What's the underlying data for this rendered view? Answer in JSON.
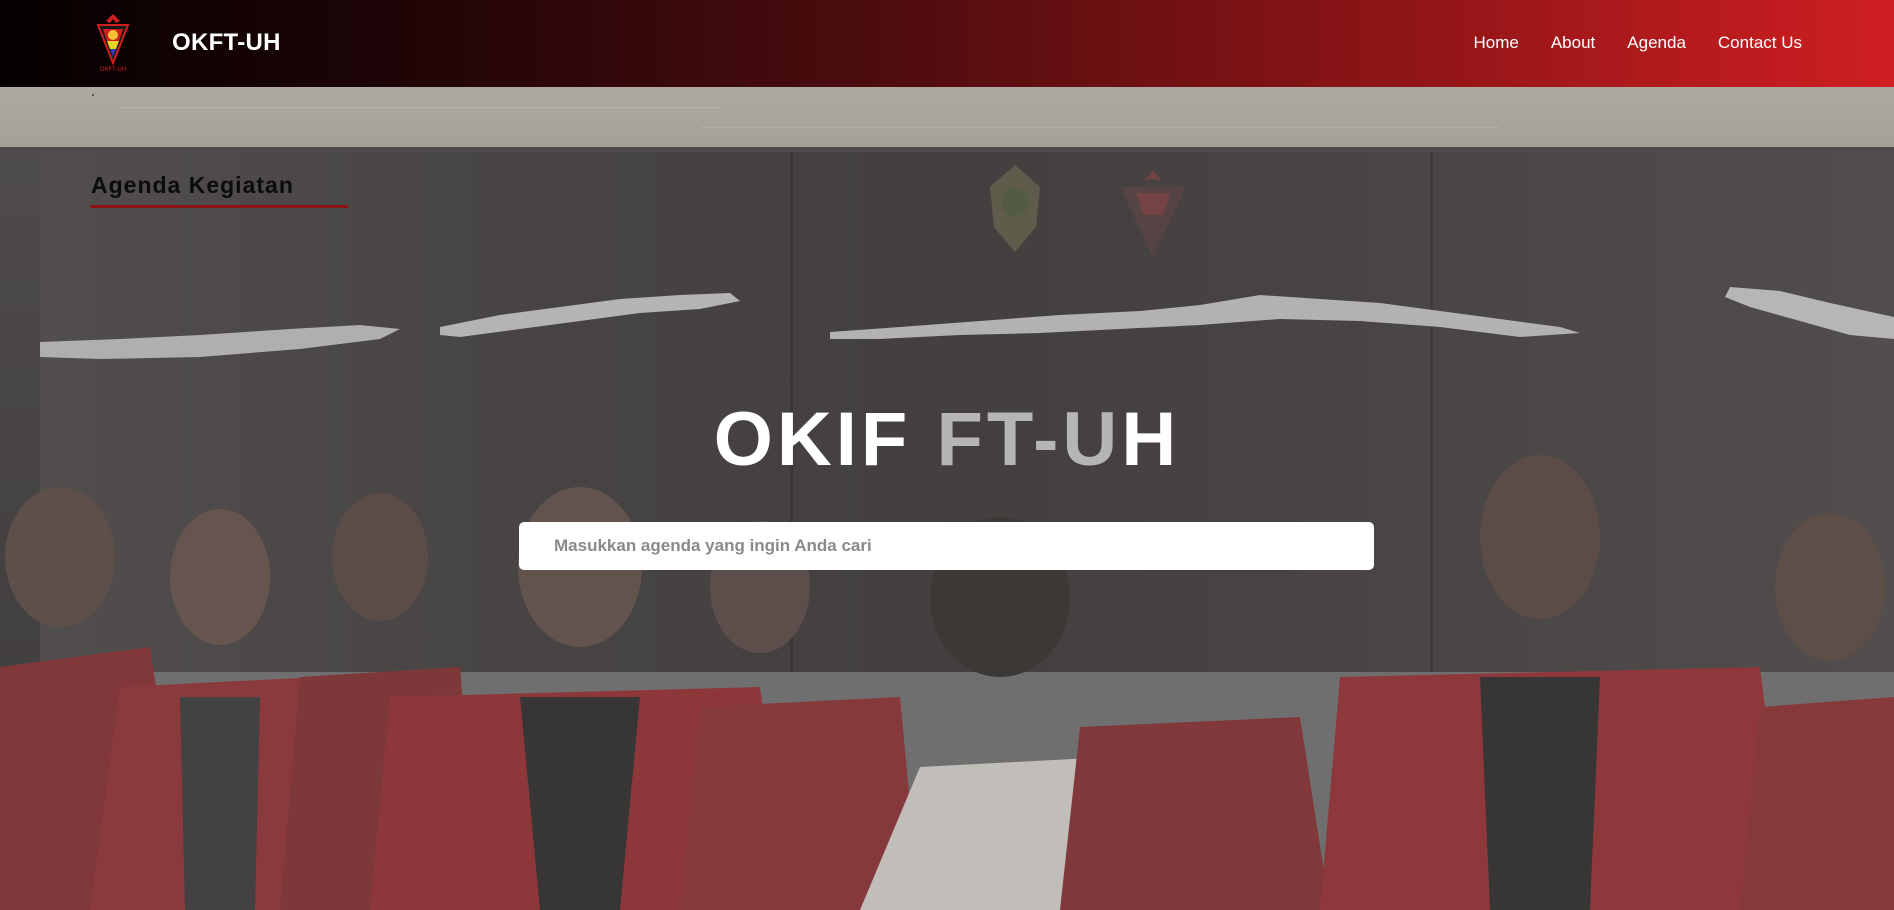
{
  "header": {
    "brand": "OKFT-UH",
    "logo_text": "OKFT-UH",
    "nav": [
      {
        "label": "Home"
      },
      {
        "label": "About"
      },
      {
        "label": "Agenda"
      },
      {
        "label": "Contact Us"
      }
    ]
  },
  "hero": {
    "section_title": "Agenda Kegiatan",
    "heading_part1": "OKIF ",
    "heading_part2": "FT-U",
    "heading_part3": "H",
    "search_placeholder": "Masukkan agenda yang ingin Anda cari"
  },
  "colors": {
    "nav_gradient_start": "#050000",
    "nav_gradient_end": "#cf1f22",
    "accent_underline": "#8c1414",
    "jacket_red": "#a8262b"
  }
}
